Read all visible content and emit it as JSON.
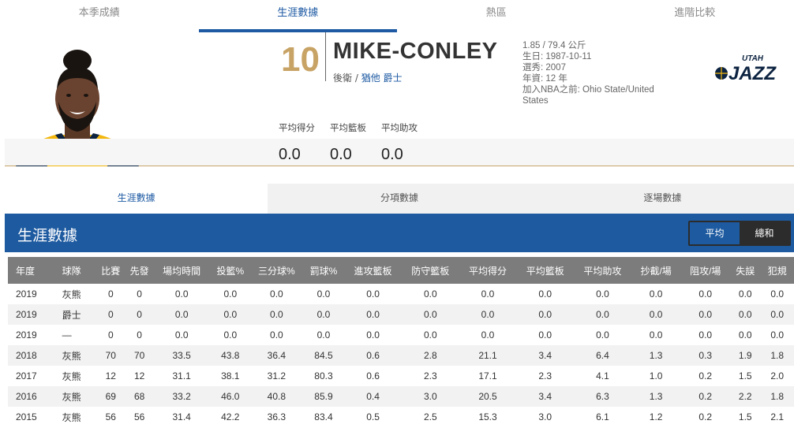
{
  "tabs": [
    {
      "label": "本季成績",
      "active": false
    },
    {
      "label": "生涯數據",
      "active": true
    },
    {
      "label": "熱區",
      "active": false
    },
    {
      "label": "進階比較",
      "active": false
    }
  ],
  "player": {
    "number": "10",
    "name": "MIKE-CONLEY",
    "position": "後衛",
    "separator": " / ",
    "team": "猶他 爵士",
    "bio": {
      "height_weight": "1.85 / 79.4 公斤",
      "birth": "生日: 1987-10-11",
      "draft": "選秀: 2007",
      "experience": "年資: 12 年",
      "origin": "加入NBA之前: Ohio State/United States"
    },
    "logo": {
      "top_text": "UTAH",
      "main_text": "JAZZ"
    },
    "summary_labels": [
      "平均得分",
      "平均籃板",
      "平均助攻"
    ],
    "summary_values": [
      "0.0",
      "0.0",
      "0.0"
    ]
  },
  "subtabs": [
    {
      "label": "生涯數據",
      "active": true
    },
    {
      "label": "分項數據",
      "active": false
    },
    {
      "label": "逐場數據",
      "active": false
    }
  ],
  "section": {
    "title": "生涯數據",
    "toggle": [
      {
        "label": "平均",
        "active": true
      },
      {
        "label": "總和",
        "active": false
      }
    ]
  },
  "table": {
    "columns": [
      "年度",
      "球隊",
      "比賽",
      "先發",
      "場均時間",
      "投籃%",
      "三分球%",
      "罰球%",
      "進攻籃板",
      "防守籃板",
      "平均得分",
      "平均籃板",
      "平均助攻",
      "抄截/場",
      "阻攻/場",
      "失誤",
      "犯規"
    ],
    "rows": [
      [
        "2019",
        "灰熊",
        "0",
        "0",
        "0.0",
        "0.0",
        "0.0",
        "0.0",
        "0.0",
        "0.0",
        "0.0",
        "0.0",
        "0.0",
        "0.0",
        "0.0",
        "0.0",
        "0.0"
      ],
      [
        "2019",
        "爵士",
        "0",
        "0",
        "0.0",
        "0.0",
        "0.0",
        "0.0",
        "0.0",
        "0.0",
        "0.0",
        "0.0",
        "0.0",
        "0.0",
        "0.0",
        "0.0",
        "0.0"
      ],
      [
        "2019",
        "—",
        "0",
        "0",
        "0.0",
        "0.0",
        "0.0",
        "0.0",
        "0.0",
        "0.0",
        "0.0",
        "0.0",
        "0.0",
        "0.0",
        "0.0",
        "0.0",
        "0.0"
      ],
      [
        "2018",
        "灰熊",
        "70",
        "70",
        "33.5",
        "43.8",
        "36.4",
        "84.5",
        "0.6",
        "2.8",
        "21.1",
        "3.4",
        "6.4",
        "1.3",
        "0.3",
        "1.9",
        "1.8"
      ],
      [
        "2017",
        "灰熊",
        "12",
        "12",
        "31.1",
        "38.1",
        "31.2",
        "80.3",
        "0.6",
        "2.3",
        "17.1",
        "2.3",
        "4.1",
        "1.0",
        "0.2",
        "1.5",
        "2.0"
      ],
      [
        "2016",
        "灰熊",
        "69",
        "68",
        "33.2",
        "46.0",
        "40.8",
        "85.9",
        "0.4",
        "3.0",
        "20.5",
        "3.4",
        "6.3",
        "1.3",
        "0.2",
        "2.2",
        "1.8"
      ],
      [
        "2015",
        "灰熊",
        "56",
        "56",
        "31.4",
        "42.2",
        "36.3",
        "83.4",
        "0.5",
        "2.5",
        "15.3",
        "3.0",
        "6.1",
        "1.2",
        "0.2",
        "1.5",
        "2.1"
      ]
    ]
  },
  "colors": {
    "accent_blue": "#1d5aa0",
    "number_gold": "#c8a366",
    "header_gray": "#7c7c7c"
  }
}
